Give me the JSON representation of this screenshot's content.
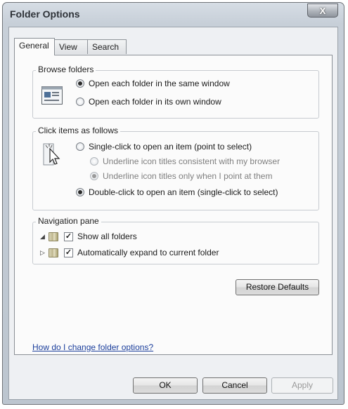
{
  "window": {
    "title": "Folder Options",
    "close_glyph": "X"
  },
  "tabs": [
    {
      "label": "General",
      "active": true
    },
    {
      "label": "View",
      "active": false
    },
    {
      "label": "Search",
      "active": false
    }
  ],
  "browse_folders": {
    "label": "Browse folders",
    "options": [
      {
        "label": "Open each folder in the same window",
        "selected": true
      },
      {
        "label": "Open each folder in its own window",
        "selected": false
      }
    ]
  },
  "click_items": {
    "label": "Click items as follows",
    "single_click": {
      "label": "Single-click to open an item (point to select)",
      "selected": false
    },
    "underline_options": [
      {
        "label": "Underline icon titles consistent with my browser",
        "selected": false,
        "disabled": true
      },
      {
        "label": "Underline icon titles only when I point at them",
        "selected": true,
        "disabled": true
      }
    ],
    "double_click": {
      "label": "Double-click to open an item (single-click to select)",
      "selected": true
    }
  },
  "navigation_pane": {
    "label": "Navigation pane",
    "options": [
      {
        "label": "Show all folders",
        "checked": true
      },
      {
        "label": "Automatically expand to current folder",
        "checked": true
      }
    ]
  },
  "buttons": {
    "restore_defaults": "Restore Defaults",
    "ok": "OK",
    "cancel": "Cancel",
    "apply": "Apply"
  },
  "help_link": "How do I change folder options?",
  "colors": {
    "accent_link": "#1c3f9c",
    "window_frame": "#c7cfd8",
    "panel_bg": "#fbfbfb"
  }
}
